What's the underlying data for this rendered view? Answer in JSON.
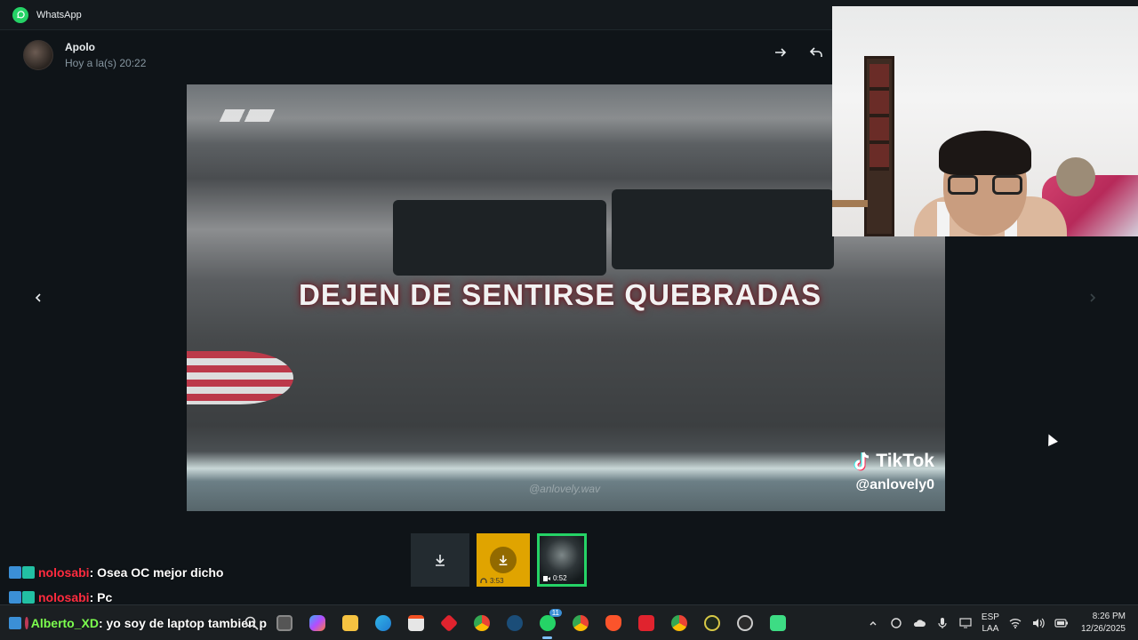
{
  "titlebar": {
    "app_name": "WhatsApp"
  },
  "header": {
    "contact_name": "Apolo",
    "timestamp": "Hoy a la(s) 20:22"
  },
  "video": {
    "caption": "DEJEN DE SENTIRSE QUEBRADAS",
    "watermark": "@anlovely.wav",
    "tiktok_brand": "TikTok",
    "tiktok_handle": "@anlovely0"
  },
  "thumbnails": [
    {
      "kind": "download"
    },
    {
      "kind": "audio",
      "duration": "3:53"
    },
    {
      "kind": "video",
      "duration": "0:52",
      "selected": true
    }
  ],
  "chat_overlay": [
    {
      "user": "nolosabi",
      "message": ": Osea OC mejor dicho",
      "user_color": "#ff2b3e"
    },
    {
      "user": "nolosabi",
      "message": ": Pc",
      "user_color": "#ff2b3e"
    },
    {
      "user": "Alberto_XD",
      "message": ": yo soy de laptop tambien p",
      "user_color": "#7cff4e"
    }
  ],
  "taskbar": {
    "language_top": "ESP",
    "language_bottom": "LAA",
    "time": "8:26 PM",
    "date": "12/26/2025",
    "whatsapp_badge": "11"
  },
  "colors": {
    "accent": "#25d366",
    "chat_red": "#ff2b3e",
    "chat_green": "#7cff4e"
  }
}
